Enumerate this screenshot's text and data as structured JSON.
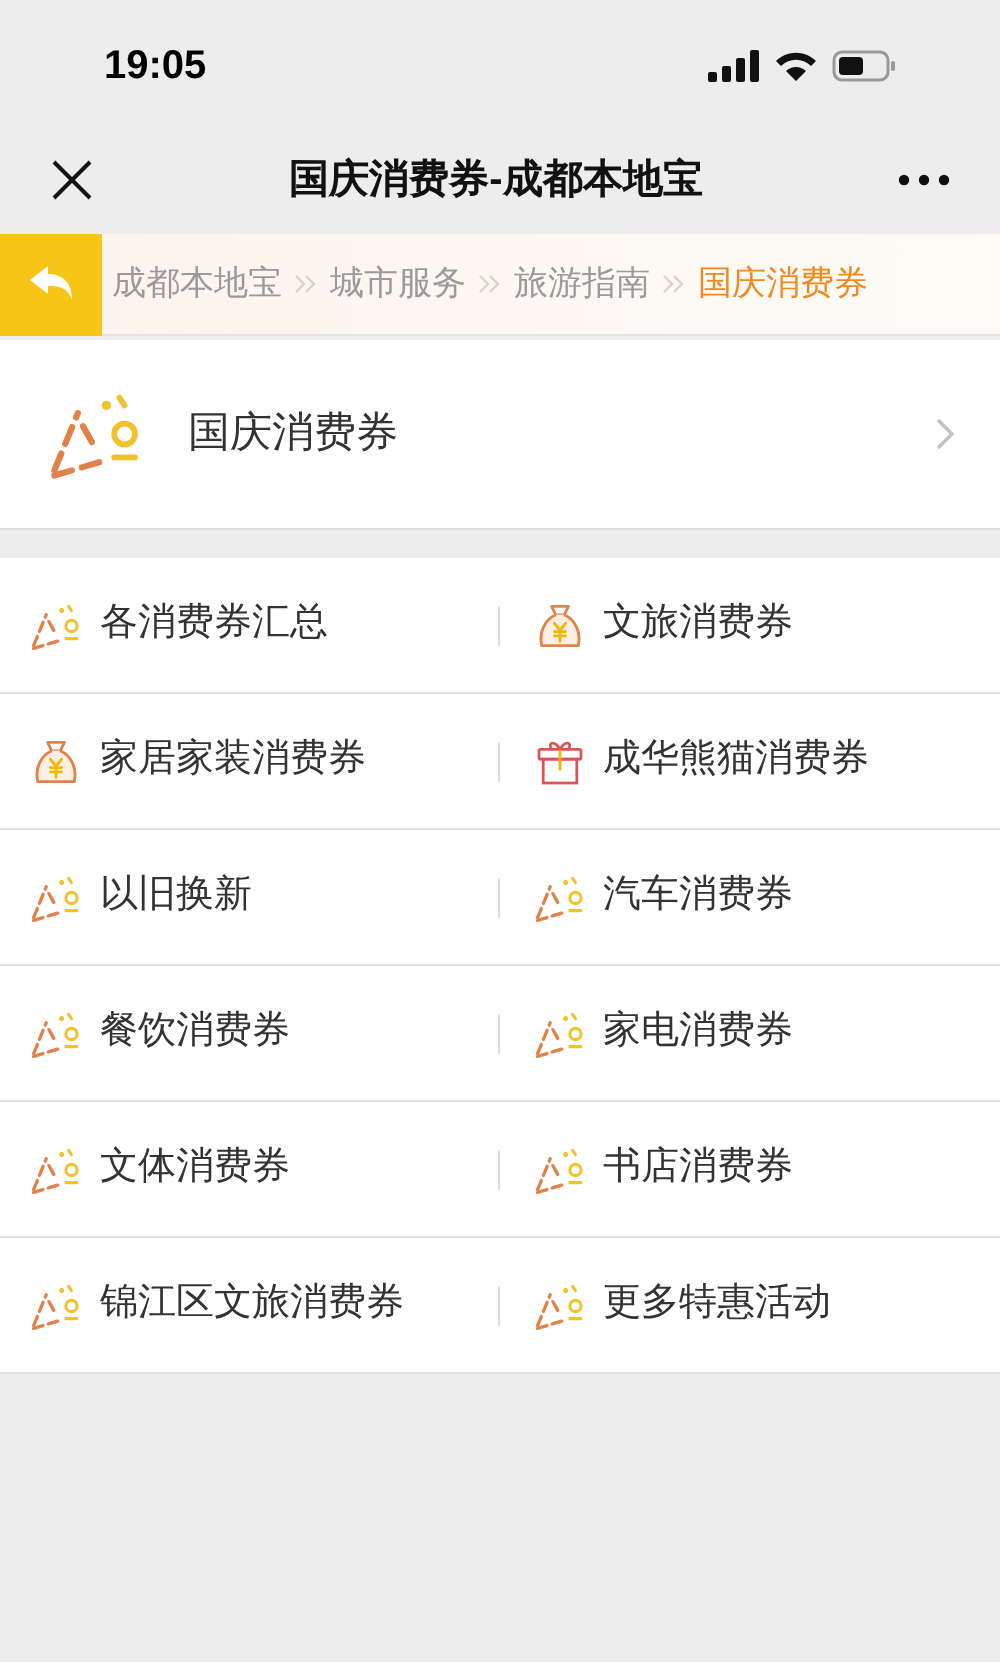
{
  "status_bar": {
    "time": "19:05"
  },
  "nav": {
    "title": "国庆消费券-成都本地宝"
  },
  "breadcrumb": [
    {
      "label": "成都本地宝",
      "selected": false
    },
    {
      "label": "城市服务",
      "selected": false
    },
    {
      "label": "旅游指南",
      "selected": false
    },
    {
      "label": "国庆消费券",
      "selected": true
    }
  ],
  "section": {
    "title": "国庆消费券",
    "kind": "popper"
  },
  "links": [
    {
      "label": "各消费券汇总",
      "kind": "popper"
    },
    {
      "label": "文旅消费券",
      "kind": "moneybag"
    },
    {
      "label": "家居家装消费券",
      "kind": "moneybag"
    },
    {
      "label": "成华熊猫消费券",
      "kind": "gift"
    },
    {
      "label": "以旧换新",
      "kind": "popper"
    },
    {
      "label": "汽车消费券",
      "kind": "popper"
    },
    {
      "label": "餐饮消费券",
      "kind": "popper"
    },
    {
      "label": "家电消费券",
      "kind": "popper"
    },
    {
      "label": "文体消费券",
      "kind": "popper"
    },
    {
      "label": "书店消费券",
      "kind": "popper"
    },
    {
      "label": "锦江区文旅消费券",
      "kind": "popper"
    },
    {
      "label": "更多特惠活动",
      "kind": "popper"
    }
  ]
}
